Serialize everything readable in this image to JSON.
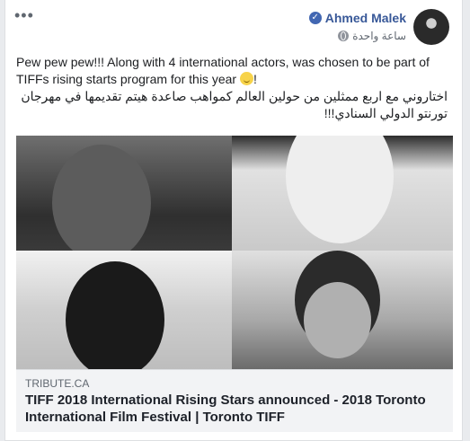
{
  "post": {
    "author_name": "Ahmed Malek",
    "time_label": "ساعة واحدة",
    "more_glyph": "•••",
    "text_en": "Pew pew pew!!! Along with 4 international actors, was chosen to be part of TIFFs rising starts program for this year",
    "text_en_suffix": "!",
    "text_ar": "اختاروني مع اربع ممثلين من حولين العالم كمواهب صاعدة هيتم تقديمها في مهرجان تورنتو الدولي السنادي!!!"
  },
  "link_preview": {
    "domain": "TRIBUTE.CA",
    "title": "TIFF 2018 International Rising Stars announced - 2018 Toronto International Film Festival | Toronto TIFF"
  },
  "icons": {
    "more": "more-options-icon",
    "verified": "verified-badge-icon",
    "privacy": "globe-icon",
    "emoji": "smiley-emoji-icon"
  },
  "colors": {
    "author_link": "#385898",
    "verified_badge": "#4267b2",
    "background": "#e9ebee",
    "link_preview_bg": "#f2f3f5"
  }
}
